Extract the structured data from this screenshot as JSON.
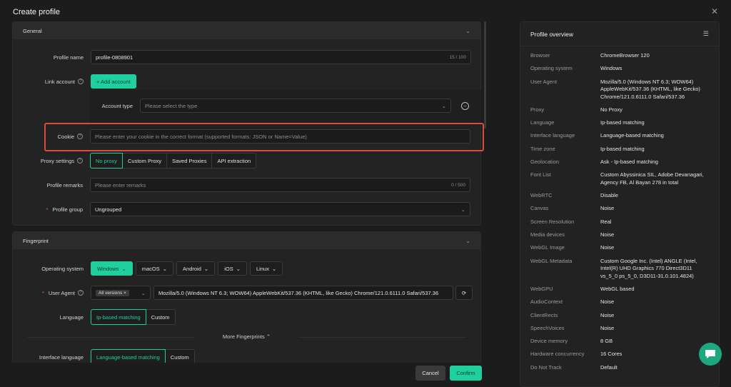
{
  "window": {
    "title": "Create profile"
  },
  "general": {
    "section_label": "General",
    "profile_name_label": "Profile name",
    "profile_name_value": "profile-0808901",
    "profile_name_count": "15 / 100",
    "link_account_label": "Link account",
    "add_account_label": "+ Add account",
    "account_type_label": "Account type",
    "account_type_placeholder": "Please select the type",
    "cookie_label": "Cookie",
    "cookie_placeholder": "Please enter your cookie in the correct format (supported formats: JSON or Name=Value)",
    "proxy_label": "Proxy settings",
    "proxy_options": [
      "No proxy",
      "Custom Proxy",
      "Saved Proxies",
      "API extraction"
    ],
    "remarks_label": "Profile remarks",
    "remarks_placeholder": "Please enter remarks",
    "remarks_count": "0 / 500",
    "group_label": "Profile group",
    "group_value": "Ungrouped"
  },
  "fingerprint": {
    "section_label": "Fingerprint",
    "os_label": "Operating system",
    "os_options": [
      "Windows",
      "macOS",
      "Android",
      "iOS",
      "Linux"
    ],
    "ua_label": "User Agent",
    "ua_tag": "All versions",
    "ua_value": "Mozilla/5.0 (Windows NT 6.3; WOW64) AppleWebKit/537.36 (KHTML, like Gecko) Chrome/121.0.6111.0 Safari/537.36",
    "language_label": "Language",
    "language_options": [
      "Ip-based matching",
      "Custom"
    ],
    "more_label": "More Fingerprints",
    "interface_label": "Interface language",
    "interface_options": [
      "Language-based matching",
      "Custom"
    ]
  },
  "footer": {
    "cancel": "Cancel",
    "confirm": "Confirm"
  },
  "overview": {
    "title": "Profile overview",
    "rows": [
      {
        "k": "Browser",
        "v": "ChromeBrowser 120"
      },
      {
        "k": "Operating system",
        "v": "Windows"
      },
      {
        "k": "User Agent",
        "v": "Mozilla/5.0 (Windows NT 6.3; WOW64) AppleWebKit/537.36 (KHTML, like Gecko) Chrome/121.0.6111.0 Safari/537.36"
      },
      {
        "k": "Proxy",
        "v": "No Proxy"
      },
      {
        "k": "Language",
        "v": "Ip-based matching"
      },
      {
        "k": "Interface language",
        "v": "Language-based matching"
      },
      {
        "k": "Time zone",
        "v": "Ip-based matching"
      },
      {
        "k": "Geolocation",
        "v": "Ask - Ip-based matching"
      },
      {
        "k": "Font List",
        "v": "Custom Abyssinica SIL, Adobe Devanagari, Agency FB, Al Bayan 278 in total"
      },
      {
        "k": "WebRTC",
        "v": "Disable"
      },
      {
        "k": "Canvas",
        "v": "Noise"
      },
      {
        "k": "Screen Resolution",
        "v": "Real"
      },
      {
        "k": "Media devices",
        "v": "Noise"
      },
      {
        "k": "WebGL Image",
        "v": "Noise"
      },
      {
        "k": "WebGL Metadata",
        "v": "Custom Google Inc. (Intel) ANGLE (Intel, Intel(R) UHD Graphics 770 Direct3D11 vs_5_0 ps_5_0, D3D11-31.0.101.4824)"
      },
      {
        "k": "WebGPU",
        "v": "WebGL based"
      },
      {
        "k": "AudioContext",
        "v": "Noise"
      },
      {
        "k": "ClientRects",
        "v": "Noise"
      },
      {
        "k": "SpeechVoices",
        "v": "Noise"
      },
      {
        "k": "Device memory",
        "v": "8 GB"
      },
      {
        "k": "Hardware concurrency",
        "v": "16 Cores"
      },
      {
        "k": "Do Not Track",
        "v": "Default"
      }
    ]
  },
  "colors": {
    "accent": "#1fcf9f",
    "highlight": "#e04a3a"
  }
}
